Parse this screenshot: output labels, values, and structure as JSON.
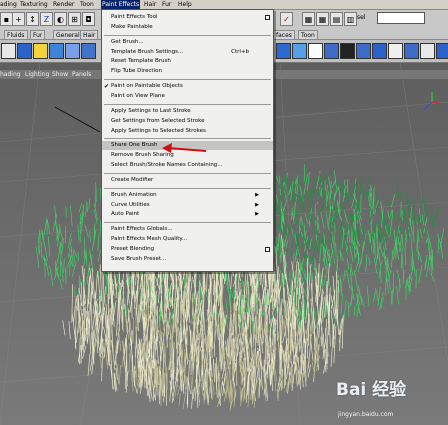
{
  "menubar": {
    "items": [
      "ading",
      "Texturing",
      "Render",
      "Toon",
      "Paint Effects",
      "Hair",
      "Fur",
      "Help"
    ],
    "active_index": 4
  },
  "toolbar": {
    "sel_label": "sel",
    "sel_value": ""
  },
  "shelf_tabs": [
    "Fluids",
    "Fur",
    "General",
    "Hair",
    "faces",
    "Toon"
  ],
  "viewport_menu": [
    "hading",
    "Lighting",
    "Show",
    "Panels"
  ],
  "menu": {
    "title": "Paint Effects",
    "items": [
      {
        "label": "Paint Effects Tool",
        "option_box": true
      },
      {
        "label": "Make Paintable"
      },
      {
        "label": "Get Brush..."
      },
      {
        "label": "Template Brush Settings...",
        "shortcut": "Ctrl+b"
      },
      {
        "label": "Reset Template Brush"
      },
      {
        "label": "Flip Tube Direction"
      },
      {
        "label": "Paint on Paintable Objects",
        "checked": true
      },
      {
        "label": "Paint on View Plane"
      },
      {
        "label": "Apply Settings to Last Stroke"
      },
      {
        "label": "Get Settings from Selected Stroke"
      },
      {
        "label": "Apply Settings to Selected Strokes"
      },
      {
        "label": "Share One Brush",
        "highlighted": true
      },
      {
        "label": "Remove Brush Sharing"
      },
      {
        "label": "Select Brush/Stroke Names Containing..."
      },
      {
        "label": "Create Modifier"
      },
      {
        "label": "Brush Animation",
        "submenu": true
      },
      {
        "label": "Curve Utilities",
        "submenu": true
      },
      {
        "label": "Auto Paint",
        "submenu": true
      },
      {
        "label": "Paint Effects Globals..."
      },
      {
        "label": "Paint Effects Mesh Quality..."
      },
      {
        "label": "Preset Blending",
        "option_box": true
      },
      {
        "label": "Save Brush Preset..."
      }
    ]
  },
  "watermark": {
    "brand": "Bai 经验",
    "url": "jingyan.baidu.com"
  },
  "colors": {
    "menubar_bg": "#d4d0c8",
    "menu_bg": "#f0f0ee",
    "highlight": "#c4c4c4",
    "arrow": "#d01010",
    "grass_green": "#3fcf63",
    "grass_white": "#e8e6c4"
  }
}
